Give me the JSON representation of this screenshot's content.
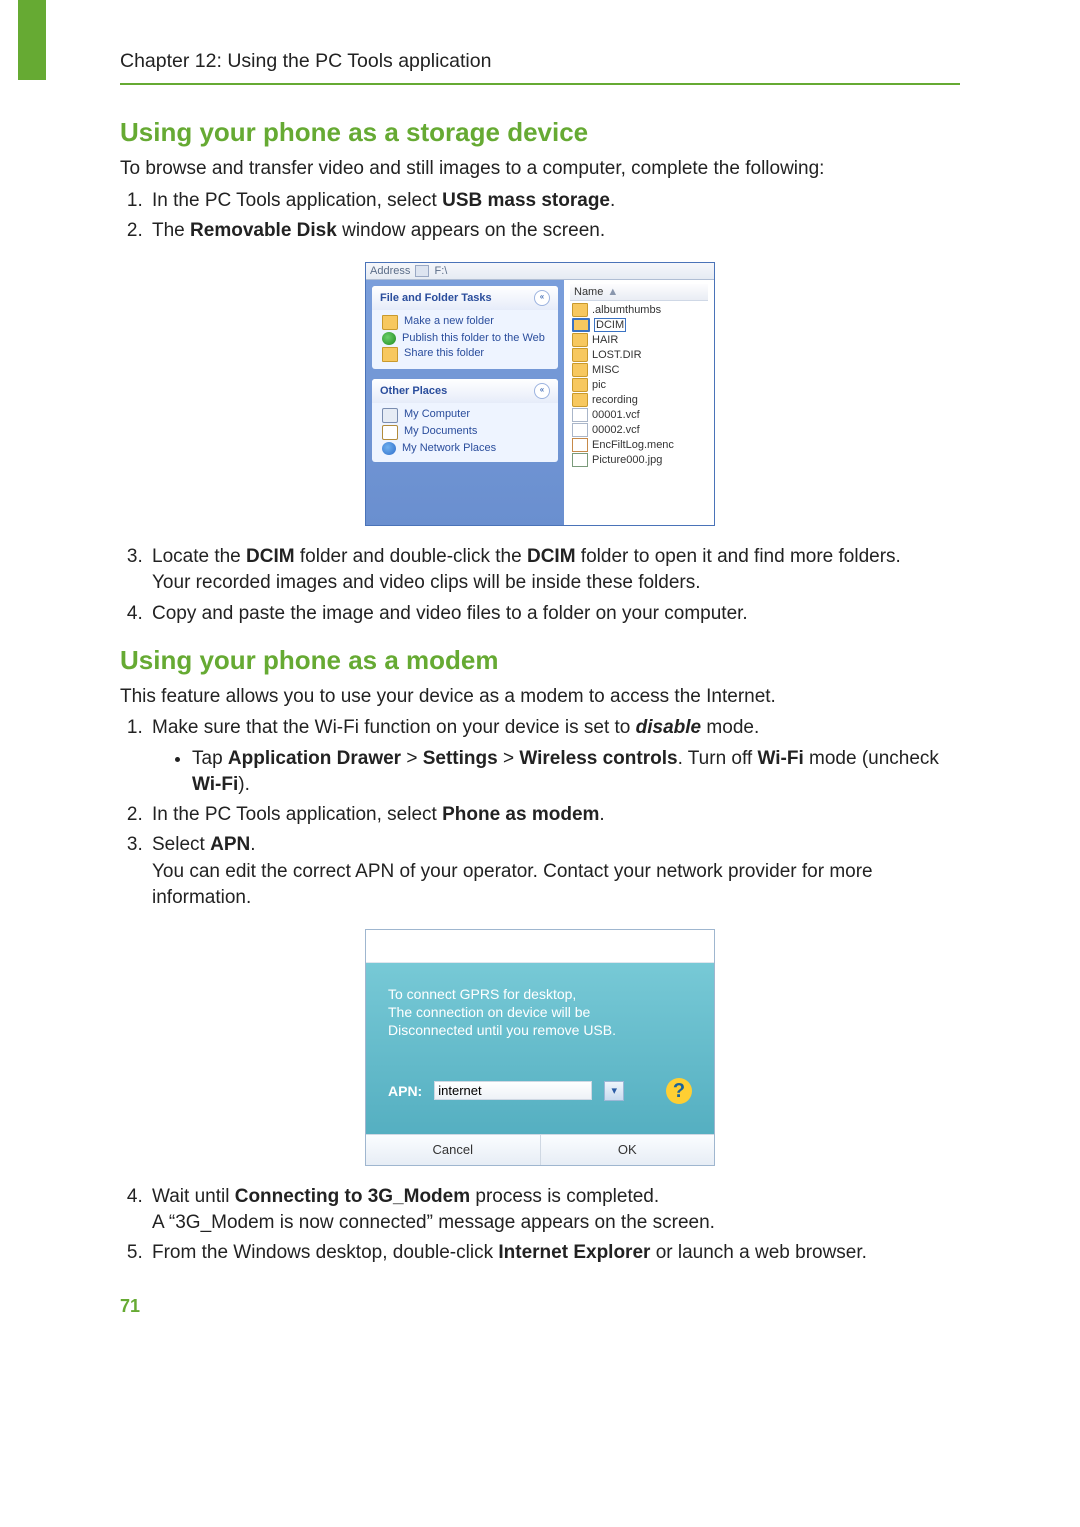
{
  "chapter_header": "Chapter 12: Using the PC Tools application",
  "page_number": "71",
  "section1": {
    "title": "Using your phone as a storage device",
    "intro": "To browse and transfer video and still images to a computer, complete the following:",
    "steps": {
      "s1_pre": "In the PC Tools application, select ",
      "s1_bold": "USB mass storage",
      "s1_post": ".",
      "s2_pre": "The ",
      "s2_bold": "Removable Disk",
      "s2_post": " window appears on the screen.",
      "s3_a": "Locate the ",
      "s3_b": "DCIM",
      "s3_c": " folder and double-click the ",
      "s3_d": "DCIM",
      "s3_e": " folder to open it and find more folders.",
      "s3_sub": "Your recorded images and video clips will be inside inside these folders.",
      "s3_sub_text": "Your recorded images and video clips will be inside these folders.",
      "s4": "Copy and paste the image and video files to a folder on your computer."
    }
  },
  "explorer": {
    "addr_label": "Address",
    "addr_value": "F:\\",
    "file_tasks_title": "File and Folder Tasks",
    "file_tasks": {
      "t1": "Make a new folder",
      "t2": "Publish this folder to the Web",
      "t3": "Share this folder"
    },
    "other_places_title": "Other Places",
    "other_places": {
      "p1": "My Computer",
      "p2": "My Documents",
      "p3": "My Network Places"
    },
    "name_header": "Name",
    "files": {
      "f0": ".albumthumbs",
      "f1": "DCIM",
      "f2": "HAIR",
      "f3": "LOST.DIR",
      "f4": "MISC",
      "f5": "pic",
      "f6": "recording",
      "f7": "00001.vcf",
      "f8": "00002.vcf",
      "f9": "EncFiltLog.menc",
      "f10": "Picture000.jpg"
    }
  },
  "section2": {
    "title": "Using your phone as a modem",
    "intro": "This feature allows you to use your device as a modem to access the Internet.",
    "steps": {
      "s1_a": "Make sure that the Wi-Fi function on your device is set to ",
      "s1_b": "disable",
      "s1_c": " mode.",
      "s1_bullet_a": "Tap ",
      "s1_bullet_b": "Application Drawer",
      "s1_bullet_c": " > ",
      "s1_bullet_d": "Settings",
      "s1_bullet_e": " > ",
      "s1_bullet_f": "Wireless controls",
      "s1_bullet_g": ". Turn off ",
      "s1_bullet_h": "Wi-Fi",
      "s1_bullet_i": " mode (uncheck ",
      "s1_bullet_j": "Wi-Fi",
      "s1_bullet_k": ").",
      "s2_a": "In the PC Tools application, select ",
      "s2_b": "Phone as modem",
      "s2_c": ".",
      "s3_a": "Select ",
      "s3_b": "APN",
      "s3_c": ".",
      "s3_sub": "You can edit the correct APN of your operator. Contact your network provider for more information.",
      "s4_a": "Wait until ",
      "s4_b": "Connecting to 3G_Modem",
      "s4_c": " process is completed.",
      "s4_sub": "A “3G_Modem is now connected” message appears on the screen.",
      "s5_a": "From the Windows desktop, double-click ",
      "s5_b": "Internet Explorer",
      "s5_c": " or launch a web browser."
    }
  },
  "apn": {
    "line1": "To connect GPRS for desktop,",
    "line2": "The connection on device will be",
    "line3": "Disconnected until you remove USB.",
    "label": "APN:",
    "value": "internet",
    "cancel": "Cancel",
    "ok": "OK",
    "help": "?"
  }
}
